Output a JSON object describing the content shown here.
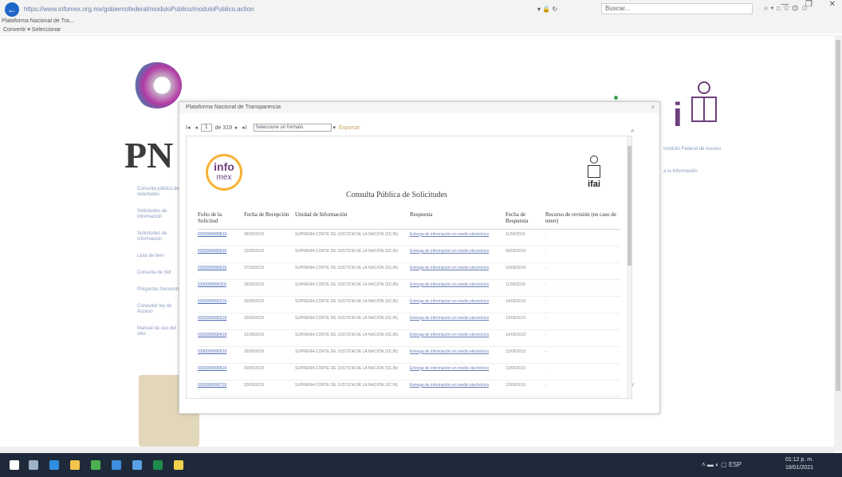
{
  "browser": {
    "url": "https://www.infomex.org.mx/gobiernofederal/moduloPublico/moduloPublico.action",
    "reload_icon": "reload-icon",
    "search_placeholder": "Buscar...",
    "tab_title": "Plataforma Nacional de Tra...",
    "favorites": "Convertir ▾  Seleccionar"
  },
  "page": {
    "brand_text": "PN",
    "side_links": [
      "Consulta pública de solicitudes",
      "Solicitudes de información",
      "Solicitudes de información",
      "Lista de tiem",
      "Consulta de Sol",
      "Preguntas frecuentes",
      "Consultar ley de Acceso",
      "Manual de uso del sitio"
    ],
    "right_text_1": "Instituto Federal de Acceso",
    "right_text_2": "a la Información"
  },
  "modal": {
    "title": "Plataforma Nacional de Transparencia",
    "close": "×",
    "toolbar": {
      "first": "I◂",
      "prev": "◂",
      "page": "1",
      "of": "de 319",
      "next": "▸",
      "last": "▸I",
      "format_placeholder": "Seleccione un formato",
      "export": "Exportar"
    },
    "report": {
      "logo_line1": "info",
      "logo_line2": "mex",
      "ifai": "ifai",
      "title": "Consulta Pública de Solicitudes",
      "headers": [
        "Folio de la Solicitud",
        "Fecha de Recepción",
        "Unidad de Información",
        "Respuesta",
        "Fecha de Respuesta",
        "Recurso de revisión (en caso de tener)"
      ],
      "rows": [
        {
          "folio": "0330000089819",
          "fecha": "28/05/2019",
          "unidad": "SUPREMA CORTE DE JUSTICIA DE LA NACIÓN (SCJN)",
          "respuesta": "Entrega de información en medio electrónico",
          "resp_fecha": "11/06/2019",
          "recurso": "-"
        },
        {
          "folio": "0330000089919",
          "fecha": "23/05/2019",
          "unidad": "SUPREMA CORTE DE JUSTICIA DE LA NACIÓN (SCJN)",
          "respuesta": "Entrega de información en medio electrónico",
          "resp_fecha": "06/06/2019",
          "recurso": "-"
        },
        {
          "folio": "0330000090019",
          "fecha": "27/05/2019",
          "unidad": "SUPREMA CORTE DE JUSTICIA DE LA NACIÓN (SCJN)",
          "respuesta": "Entrega de información en medio electrónico",
          "resp_fecha": "10/06/2019",
          "recurso": "-"
        },
        {
          "folio": "0330000090119",
          "fecha": "28/05/2019",
          "unidad": "SUPREMA CORTE DE JUSTICIA DE LA NACIÓN (SCJN)",
          "respuesta": "Entrega de información en medio electrónico",
          "resp_fecha": "11/06/2019",
          "recurso": "-"
        },
        {
          "folio": "0330000090219",
          "fecha": "30/05/2019",
          "unidad": "SUPREMA CORTE DE JUSTICIA DE LA NACIÓN (SCJN)",
          "respuesta": "Entrega de información en medio electrónico",
          "resp_fecha": "14/06/2019",
          "recurso": "-"
        },
        {
          "folio": "0330000090319",
          "fecha": "30/05/2019",
          "unidad": "SUPREMA CORTE DE JUSTICIA DE LA NACIÓN (SCJN)",
          "respuesta": "Entrega de información en medio electrónico",
          "resp_fecha": "13/06/2019",
          "recurso": "-"
        },
        {
          "folio": "0330000090419",
          "fecha": "31/05/2019",
          "unidad": "SUPREMA CORTE DE JUSTICIA DE LA NACIÓN (SCJN)",
          "respuesta": "Entrega de información en medio electrónico",
          "resp_fecha": "14/06/2019",
          "recurso": "-"
        },
        {
          "folio": "0330000090519",
          "fecha": "30/05/2019",
          "unidad": "SUPREMA CORTE DE JUSTICIA DE LA NACIÓN (SCJN)",
          "respuesta": "Entrega de información en medio electrónico",
          "resp_fecha": "13/06/2019",
          "recurso": "-"
        },
        {
          "folio": "0330000090619",
          "fecha": "30/05/2019",
          "unidad": "SUPREMA CORTE DE JUSTICIA DE LA NACIÓN (SCJN)",
          "respuesta": "Entrega de información en medio electrónico",
          "resp_fecha": "13/06/2019",
          "recurso": "-"
        },
        {
          "folio": "0330000090719",
          "fecha": "30/05/2019",
          "unidad": "SUPREMA CORTE DE JUSTICIA DE LA NACIÓN (SCJN)",
          "respuesta": "Entrega de información en medio electrónico",
          "resp_fecha": "13/06/2019",
          "recurso": "-"
        }
      ]
    }
  },
  "taskbar": {
    "time": "01:12 p. m.",
    "date": "18/01/2021",
    "lang": "ESP",
    "apps": [
      {
        "name": "start-icon",
        "color": "#ffffff"
      },
      {
        "name": "task-view-icon",
        "color": "#9fb3c8"
      },
      {
        "name": "internet-explorer-icon",
        "color": "#2f8ee0"
      },
      {
        "name": "file-explorer-icon",
        "color": "#f3c54c"
      },
      {
        "name": "chrome-icon",
        "color": "#4caf50"
      },
      {
        "name": "mail-icon",
        "color": "#3d8fe0"
      },
      {
        "name": "app-icon",
        "color": "#5aa0e6"
      },
      {
        "name": "excel-icon",
        "color": "#1f8b4c"
      },
      {
        "name": "sticky-icon",
        "color": "#f0d24c"
      }
    ]
  }
}
